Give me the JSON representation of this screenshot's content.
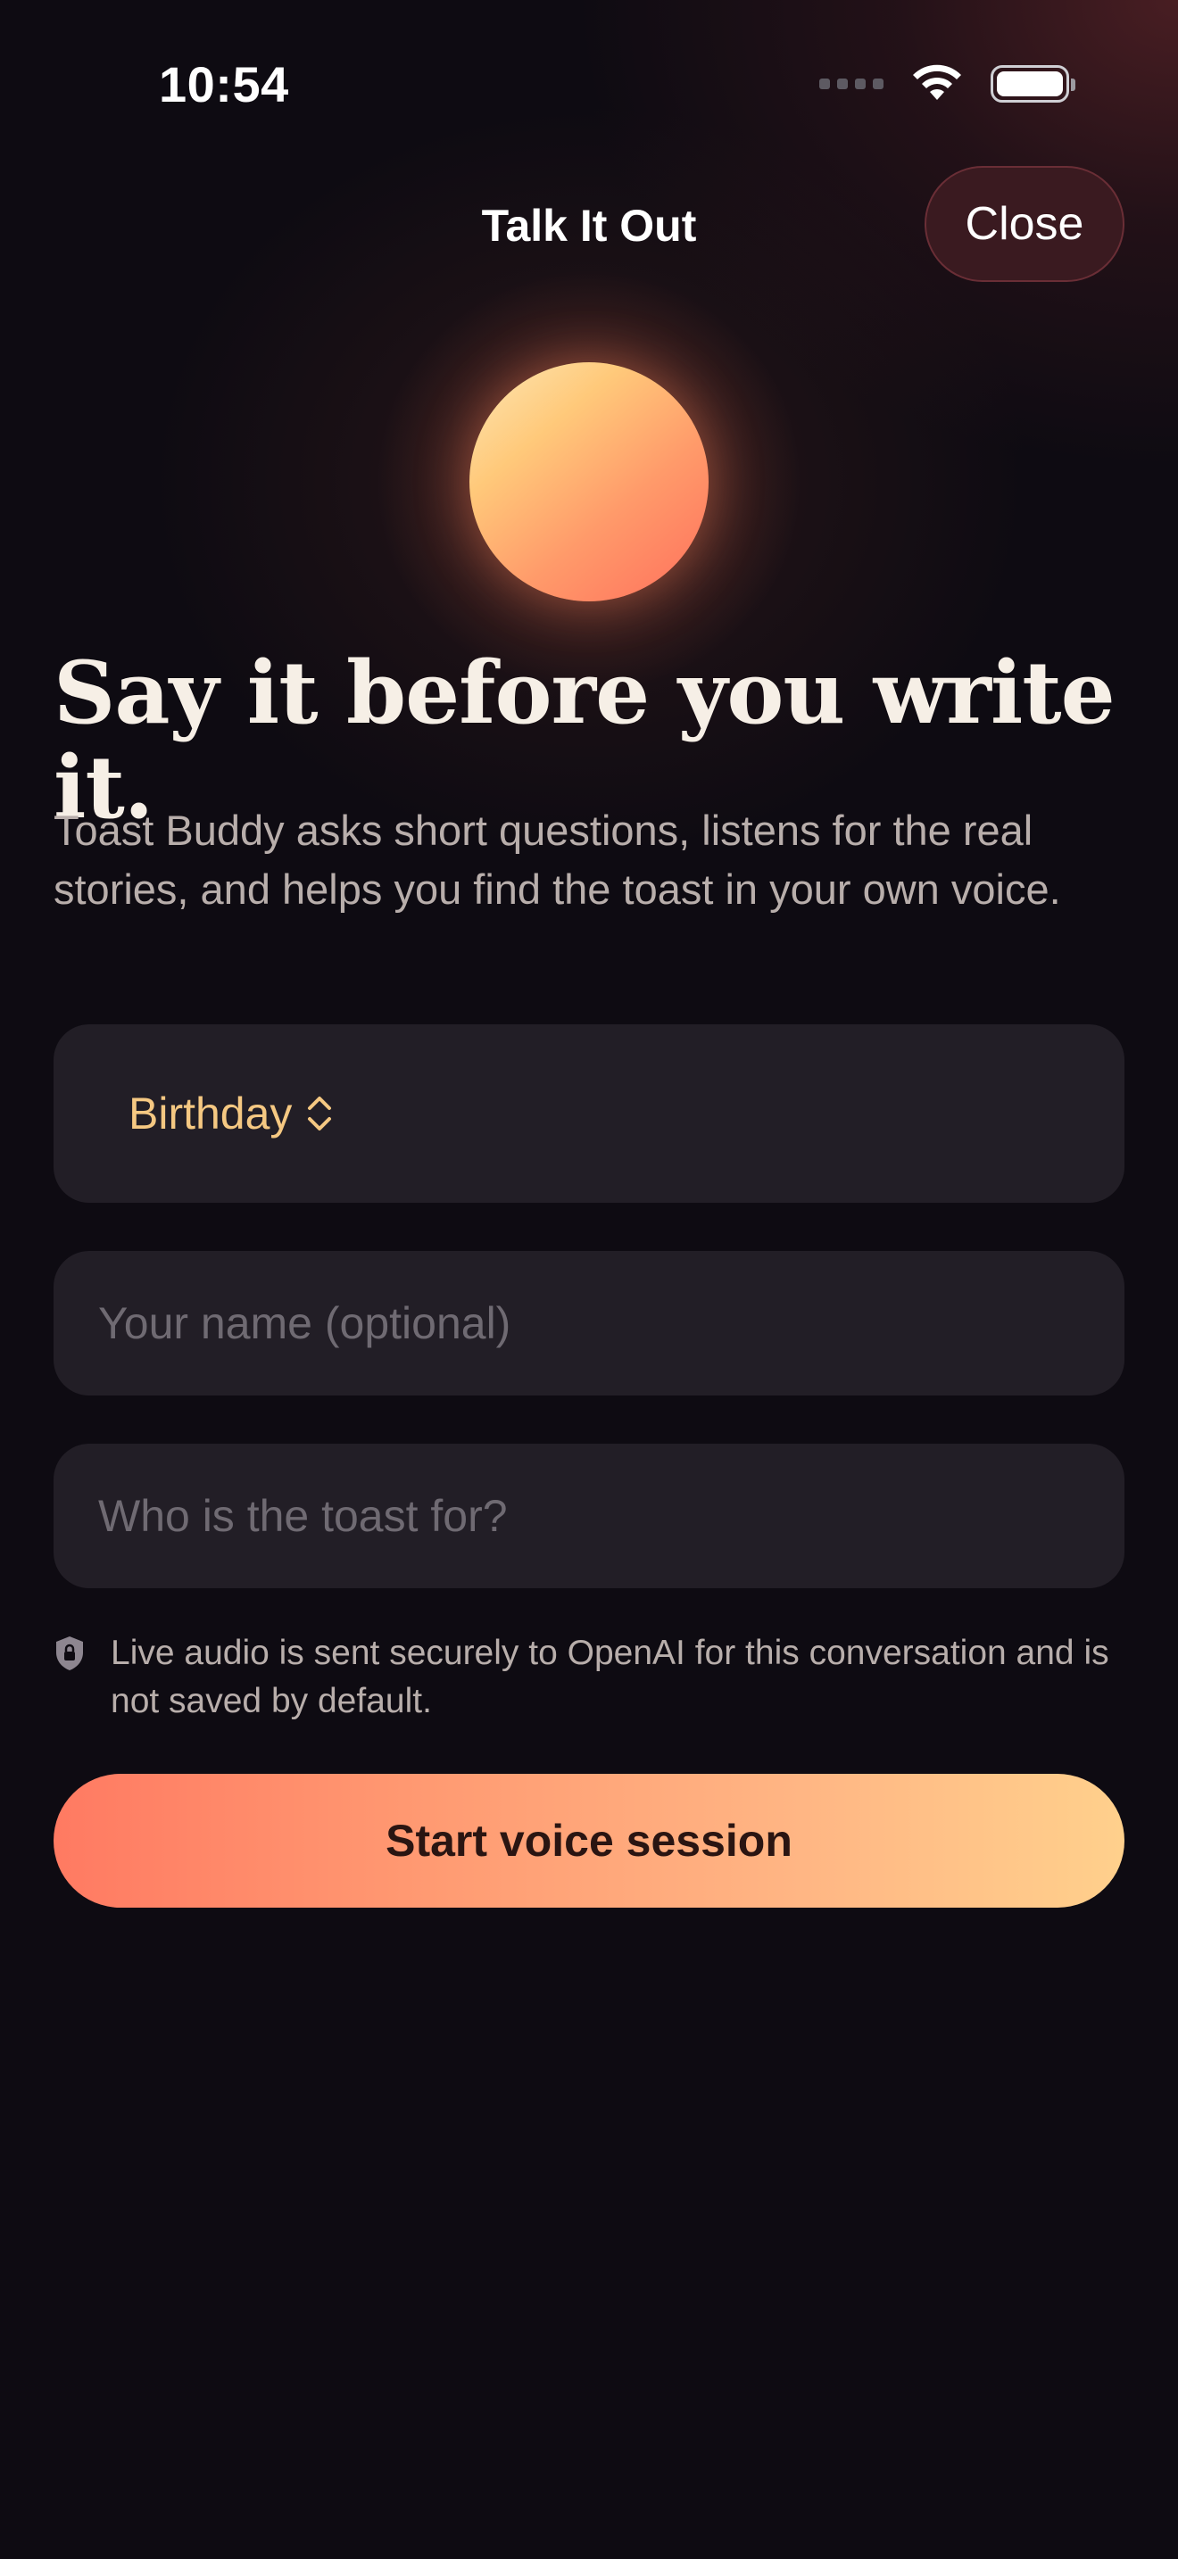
{
  "status_bar": {
    "time": "10:54"
  },
  "nav": {
    "title": "Talk It Out",
    "close_label": "Close"
  },
  "hero": {
    "headline": "Say it before you write it.",
    "description": "Toast Buddy asks short questions, listens for the real stories, and helps you find the toast in your own voice."
  },
  "form": {
    "occasion": {
      "selected": "Birthday",
      "icon": "chevron-up-down-icon"
    },
    "name_field": {
      "value": "",
      "placeholder": "Your name (optional)"
    },
    "recipient_field": {
      "value": "",
      "placeholder": "Who is the toast for?"
    }
  },
  "privacy": {
    "icon": "shield-lock-icon",
    "text": "Live audio is sent securely to OpenAI for this conversation and is not saved by default."
  },
  "cta": {
    "label": "Start voice session"
  },
  "colors": {
    "background": "#0e0b12",
    "accent_gold": "#f5c882",
    "cta_start": "#ff7a62",
    "cta_end": "#ffd08c",
    "field_bg": "#221e26"
  }
}
